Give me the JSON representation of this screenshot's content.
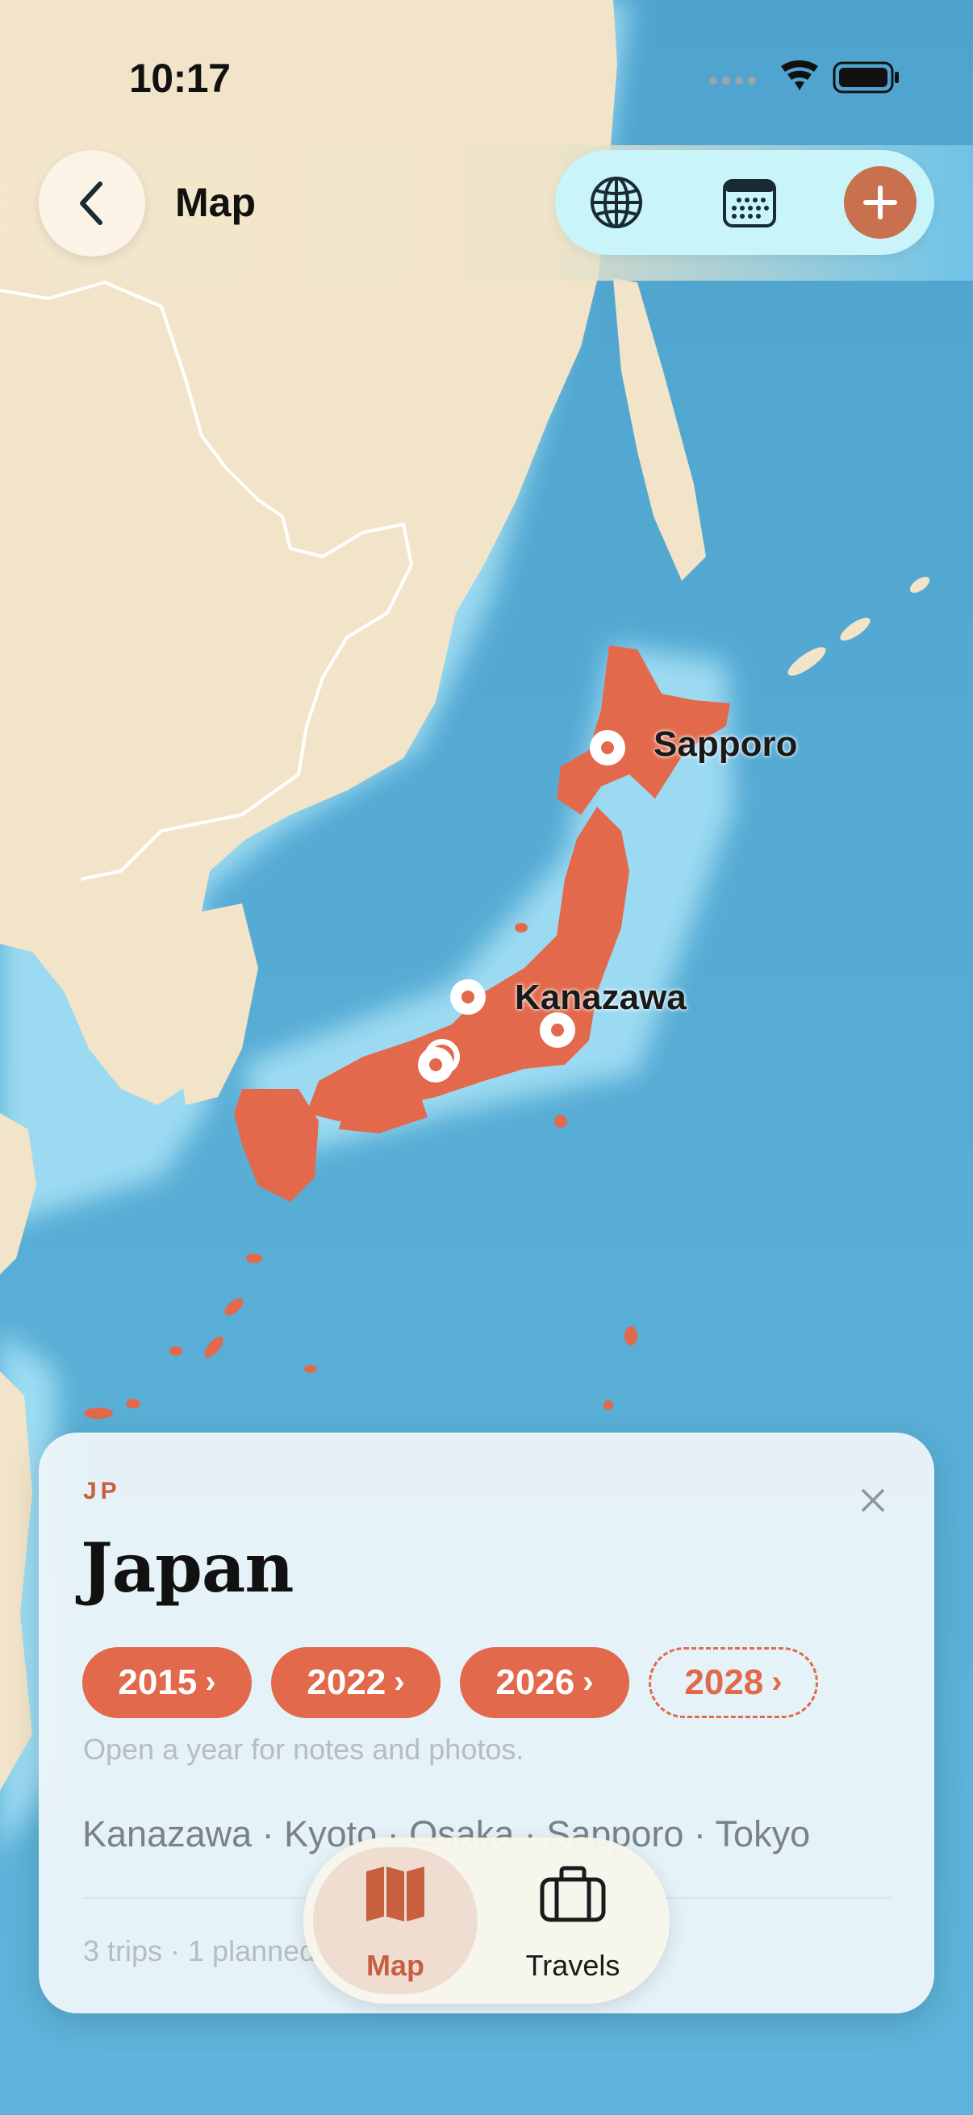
{
  "status_bar": {
    "time": "10:17"
  },
  "header": {
    "title": "Map"
  },
  "icons": {
    "back": "chevron-left-icon",
    "globe": "globe-icon",
    "calendar": "calendar-icon",
    "add": "plus-icon",
    "close": "close-icon",
    "map_tab": "map-icon",
    "travels_tab": "suitcase-icon"
  },
  "map": {
    "city_labels": [
      "Sapporo",
      "Kanazawa"
    ],
    "highlight_color": "#e2694b"
  },
  "card": {
    "country_code": "JP",
    "country_name": "Japan",
    "years": [
      {
        "label": "2015",
        "planned": false
      },
      {
        "label": "2022",
        "planned": false
      },
      {
        "label": "2026",
        "planned": false
      },
      {
        "label": "2028",
        "planned": true
      }
    ],
    "year_hint": "Open a year for notes and photos.",
    "cities": "Kanazawa · Kyoto · Osaka · Sapporo · Tokyo",
    "stats": "3 trips · 1 planned"
  },
  "tabs": {
    "map": "Map",
    "travels": "Travels"
  },
  "colors": {
    "accent": "#e2694b",
    "accent_dark": "#c8603f",
    "land": "#f2e4c8",
    "water": "#5fb2d9",
    "pill_bg": "#c8f4fa"
  }
}
